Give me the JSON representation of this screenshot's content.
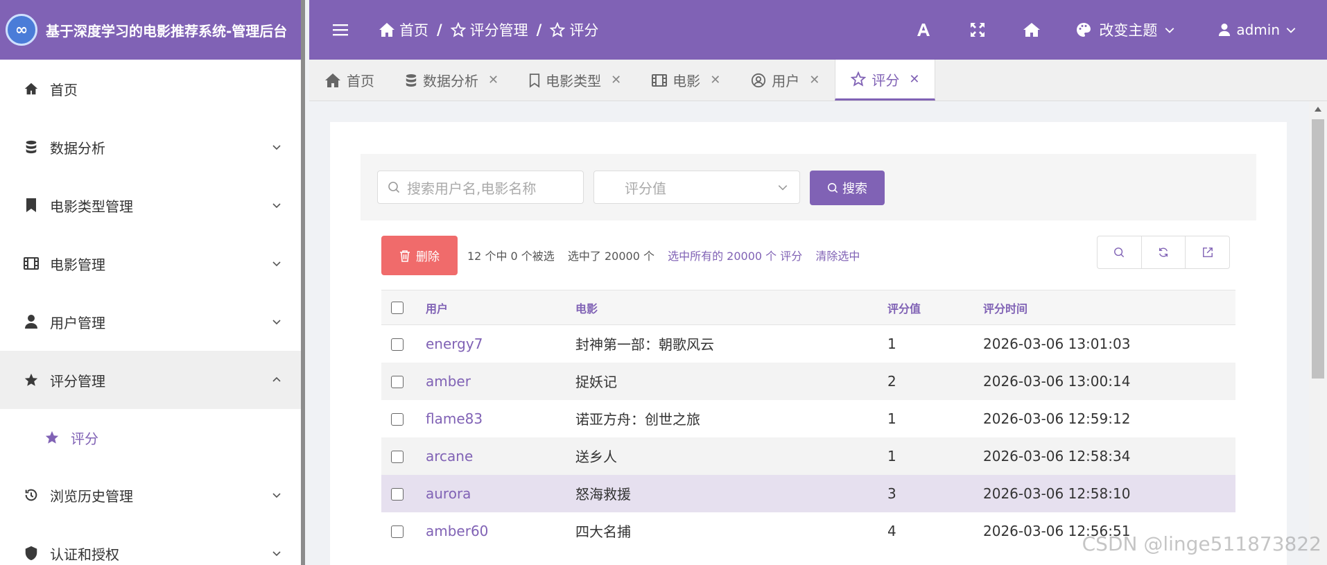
{
  "brand": {
    "title": "基于深度学习的电影推荐系统-管理后台"
  },
  "sidebar": {
    "items": [
      {
        "label": "首页",
        "icon": "home-icon"
      },
      {
        "label": "数据分析",
        "icon": "database-icon"
      },
      {
        "label": "电影类型管理",
        "icon": "bookmark-icon"
      },
      {
        "label": "电影管理",
        "icon": "film-icon"
      },
      {
        "label": "用户管理",
        "icon": "user-icon"
      },
      {
        "label": "评分管理",
        "icon": "star-icon",
        "open": true
      },
      {
        "label": "浏览历史管理",
        "icon": "history-icon"
      },
      {
        "label": "认证和授权",
        "icon": "shield-icon"
      }
    ],
    "subitems": [
      {
        "label": "评分",
        "icon": "star-icon"
      }
    ]
  },
  "header": {
    "breadcrumb": [
      "首页",
      "评分管理",
      "评分"
    ],
    "theme_label": "改变主题",
    "user_label": "admin"
  },
  "tabs": [
    {
      "label": "首页"
    },
    {
      "label": "数据分析"
    },
    {
      "label": "电影类型"
    },
    {
      "label": "电影"
    },
    {
      "label": "用户"
    },
    {
      "label": "评分",
      "active": true
    }
  ],
  "search": {
    "placeholder": "搜索用户名,电影名称",
    "select_placeholder": "评分值",
    "button_label": "搜索"
  },
  "actions": {
    "delete_label": "删除",
    "selected_count": "12 个中 0 个被选",
    "selected_total": "选中了 20000 个",
    "select_all": "选中所有的 20000 个 评分",
    "clear_selection": "清除选中"
  },
  "table": {
    "columns": [
      "用户",
      "电影",
      "评分值",
      "评分时间"
    ],
    "rows": [
      {
        "user": "energy7",
        "movie": "封神第一部：朝歌风云",
        "rating": "1",
        "time": "2026-03-06 13:01:03"
      },
      {
        "user": "amber",
        "movie": "捉妖记",
        "rating": "2",
        "time": "2026-03-06 13:00:14"
      },
      {
        "user": "flame83",
        "movie": "诺亚方舟：创世之旅",
        "rating": "1",
        "time": "2026-03-06 12:59:12"
      },
      {
        "user": "arcane",
        "movie": "送乡人",
        "rating": "1",
        "time": "2026-03-06 12:58:34"
      },
      {
        "user": "aurora",
        "movie": "怒海救援",
        "rating": "3",
        "time": "2026-03-06 12:58:10"
      },
      {
        "user": "amber60",
        "movie": "四大名捕",
        "rating": "4",
        "time": "2026-03-06 12:56:51"
      }
    ]
  },
  "watermark": "CSDN @linge511873822",
  "colors": {
    "primary": "#8062b5",
    "danger": "#f06b6b"
  }
}
